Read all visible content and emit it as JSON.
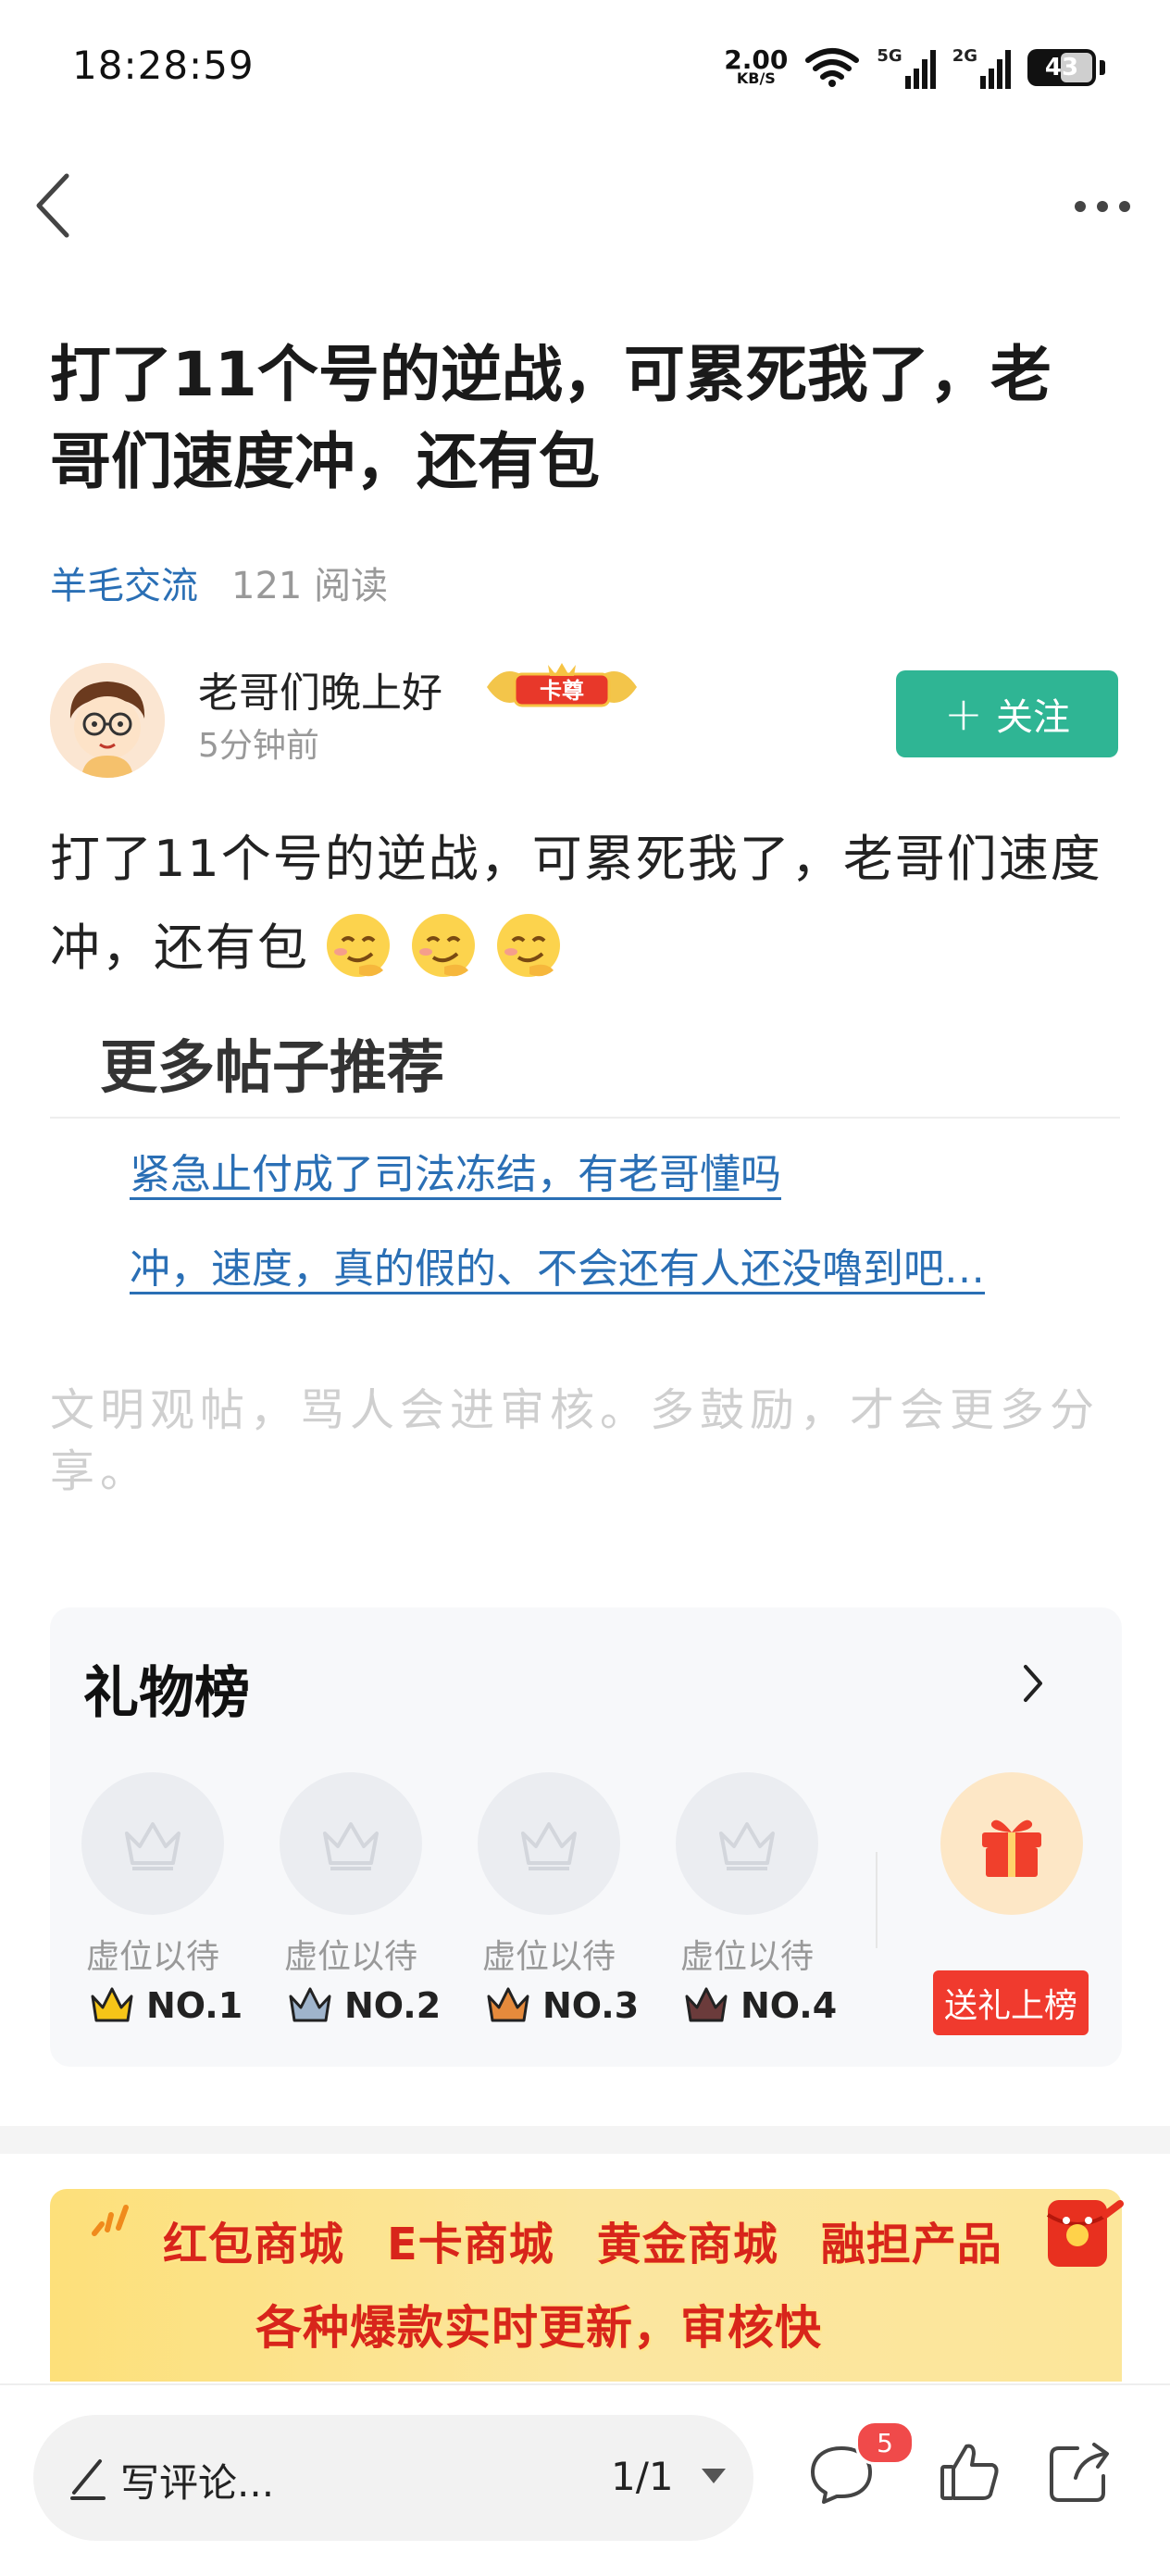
{
  "status_bar": {
    "time": "18:28:59",
    "net_speed": "2.00",
    "net_unit": "KB/S",
    "sig1_label": "5G",
    "sig2_label": "2G",
    "battery": "43"
  },
  "post": {
    "title": "打了11个号的逆战，可累死我了，老哥们速度冲，还有包",
    "category": "羊毛交流",
    "reads": "121 阅读",
    "author": "老哥们晚上好",
    "author_badge": "卡尊",
    "time_ago": "5分钟前",
    "follow_label": "关注",
    "body": "打了11个号的逆战，可累死我了，老哥们速度冲，还有包"
  },
  "more_posts": {
    "title": "更多帖子推荐",
    "items": [
      "紧急止付成了司法冻结，有老哥懂吗",
      "冲，速度，真的假的、不会还有人还没嚕到吧…"
    ]
  },
  "notice": "文明观帖，骂人会进审核。多鼓励，才会更多分享。",
  "gift_board": {
    "title": "礼物榜",
    "slots": [
      {
        "label": "虚位以待",
        "rank": "NO.1",
        "crown_color": "#f5c518"
      },
      {
        "label": "虚位以待",
        "rank": "NO.2",
        "crown_color": "#9fb4cc"
      },
      {
        "label": "虚位以待",
        "rank": "NO.3",
        "crown_color": "#e58a3c"
      },
      {
        "label": "虚位以待",
        "rank": "NO.4",
        "crown_color": "#6b3b3b"
      }
    ],
    "send_label": "送礼上榜"
  },
  "banner": {
    "items": [
      "红包商城",
      "E卡商城",
      "黄金商城",
      "融担产品"
    ],
    "tagline": "各种爆款实时更新，审核快"
  },
  "bottom_bar": {
    "comment_placeholder": "写评论...",
    "page": "1/1",
    "comment_count": "5"
  }
}
